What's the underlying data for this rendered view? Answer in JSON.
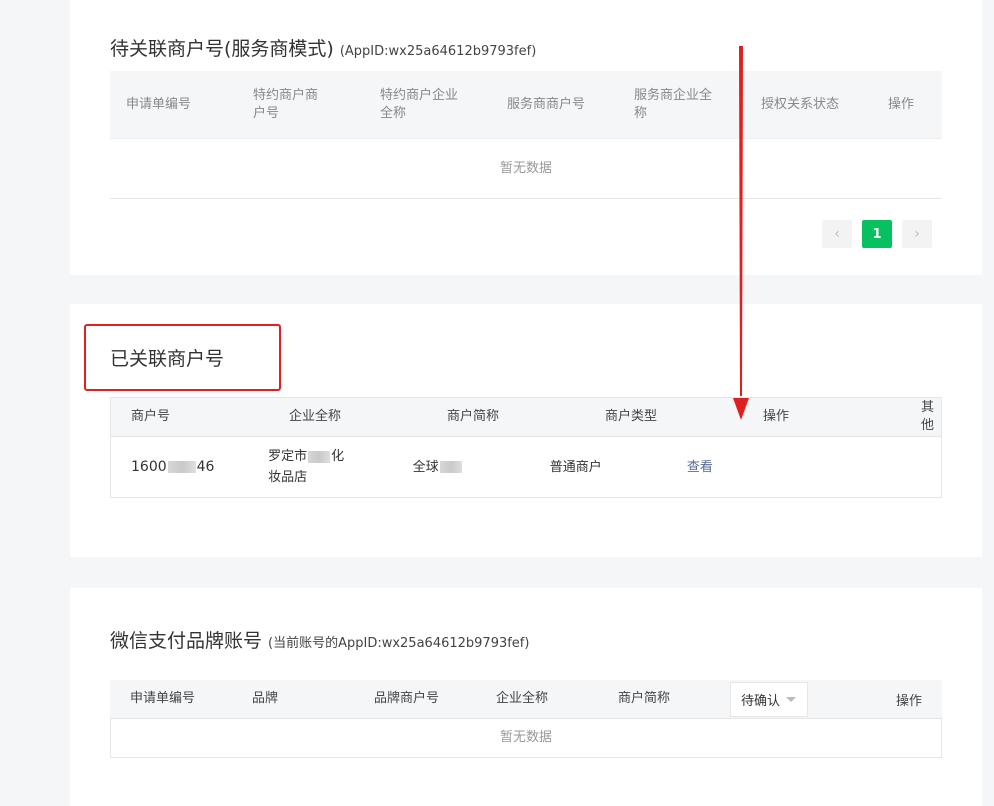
{
  "pending": {
    "title": "待关联商户号(服务商模式)",
    "subtitle": "(AppID:wx25a64612b9793fef)",
    "columns": [
      "申请单编号",
      "特约商户商户号",
      "特约商户企业全称",
      "服务商商户号",
      "服务商企业全称",
      "授权关系状态",
      "操作"
    ],
    "empty_text": "暂无数据",
    "pager": {
      "prev": "‹",
      "current": "1",
      "next": "›"
    }
  },
  "linked": {
    "title": "已关联商户号",
    "columns": [
      "商户号",
      "企业全称",
      "商户简称",
      "商户类型",
      "操作",
      "其他"
    ],
    "row": {
      "merchant_no_prefix": "1600",
      "merchant_no_suffix": "46",
      "company_prefix": "罗定市",
      "company_suffix": "化妆品店",
      "short_prefix": "全球",
      "type": "普通商户",
      "action": "查看"
    }
  },
  "brand": {
    "title": "微信支付品牌账号",
    "subtitle": "(当前账号的AppID:wx25a64612b9793fef)",
    "columns": [
      "申请单编号",
      "品牌",
      "品牌商户号",
      "企业全称",
      "商户简称"
    ],
    "status_select": "待确认",
    "action_col": "操作",
    "empty_text": "暂无数据"
  },
  "colors": {
    "accent": "#07c160",
    "link": "#576b95",
    "annotation": "#e02020"
  }
}
